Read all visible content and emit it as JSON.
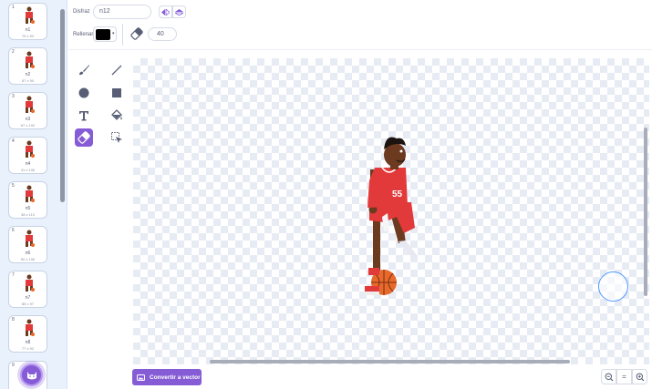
{
  "costumes": [
    {
      "num": "1",
      "name": "n1",
      "size": "79 x 92"
    },
    {
      "num": "2",
      "name": "n2",
      "size": "87 x 90"
    },
    {
      "num": "3",
      "name": "n3",
      "size": "67 x 102"
    },
    {
      "num": "4",
      "name": "n4",
      "size": "41 x 106"
    },
    {
      "num": "5",
      "name": "n5",
      "size": "38 x 113"
    },
    {
      "num": "6",
      "name": "n6",
      "size": "52 x 106"
    },
    {
      "num": "7",
      "name": "n7",
      "size": "85 x 97"
    },
    {
      "num": "8",
      "name": "n8",
      "size": "77 x 92"
    },
    {
      "num": "9",
      "name": "",
      "size": ""
    }
  ],
  "header": {
    "costume_label": "Disfraz",
    "costume_name": "n12",
    "fill_label": "Rellenar",
    "fill_color": "#000000",
    "eraser_size": "40"
  },
  "bottom": {
    "convert_label": "Convertir a vector",
    "zoom_reset_label": "="
  },
  "colors": {
    "accent": "#855cd6",
    "text": "#575e75",
    "eraser_cursor": "#4c97ff"
  },
  "icons": {
    "brush": "brush-icon",
    "line": "line-icon",
    "circle": "circle-icon",
    "rectangle": "rectangle-icon",
    "text": "text-icon",
    "fill": "fill-icon",
    "eraser": "eraser-icon",
    "select": "select-icon"
  }
}
